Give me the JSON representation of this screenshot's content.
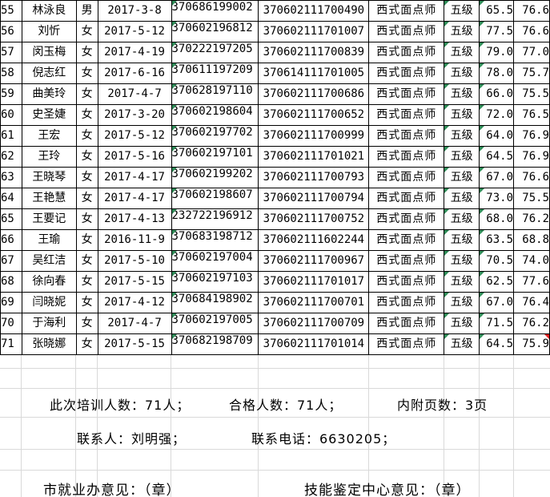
{
  "rows": [
    {
      "no": "55",
      "name": "林泳良",
      "sex": "男",
      "date": "2017-3-8",
      "id": "370686199002",
      "cert": "370602111700490",
      "job": "西式面点师",
      "level": "五级",
      "s1": "65.5",
      "s2": "76.6"
    },
    {
      "no": "56",
      "name": "刘忻",
      "sex": "女",
      "date": "2017-5-12",
      "id": "370602196812",
      "cert": "370602111701007",
      "job": "西式面点师",
      "level": "五级",
      "s1": "77.5",
      "s2": "76.6"
    },
    {
      "no": "57",
      "name": "闵玉梅",
      "sex": "女",
      "date": "2017-4-19",
      "id": "370222197205",
      "cert": "370602111700839",
      "job": "西式面点师",
      "level": "五级",
      "s1": "79.0",
      "s2": "77.0"
    },
    {
      "no": "58",
      "name": "倪志红",
      "sex": "女",
      "date": "2017-6-16",
      "id": "370611197209",
      "cert": "370614111701005",
      "job": "西式面点师",
      "level": "五级",
      "s1": "78.0",
      "s2": "75.7"
    },
    {
      "no": "59",
      "name": "曲美玲",
      "sex": "女",
      "date": "2017-4-7",
      "id": "370628197110",
      "cert": "370602111700686",
      "job": "西式面点师",
      "level": "五级",
      "s1": "66.0",
      "s2": "75.5"
    },
    {
      "no": "60",
      "name": "史圣婕",
      "sex": "女",
      "date": "2017-3-20",
      "id": "370602198604",
      "cert": "370602111700652",
      "job": "西式面点师",
      "level": "五级",
      "s1": "72.0",
      "s2": "76.5"
    },
    {
      "no": "61",
      "name": "王宏",
      "sex": "女",
      "date": "2017-5-12",
      "id": "370602197702",
      "cert": "370602111700999",
      "job": "西式面点师",
      "level": "五级",
      "s1": "64.0",
      "s2": "76.9"
    },
    {
      "no": "62",
      "name": "王玲",
      "sex": "女",
      "date": "2017-5-16",
      "id": "370602197101",
      "cert": "370602111701021",
      "job": "西式面点师",
      "level": "五级",
      "s1": "64.5",
      "s2": "76.9"
    },
    {
      "no": "63",
      "name": "王晓琴",
      "sex": "女",
      "date": "2017-4-17",
      "id": "370602199202",
      "cert": "370602111700793",
      "job": "西式面点师",
      "level": "五级",
      "s1": "67.0",
      "s2": "76.6"
    },
    {
      "no": "64",
      "name": "王艳慧",
      "sex": "女",
      "date": "2017-4-17",
      "id": "370602198607",
      "cert": "370602111700794",
      "job": "西式面点师",
      "level": "五级",
      "s1": "73.0",
      "s2": "75.5"
    },
    {
      "no": "65",
      "name": "王要记",
      "sex": "女",
      "date": "2017-4-13",
      "id": "232722196912",
      "cert": "370602111700752",
      "job": "西式面点师",
      "level": "五级",
      "s1": "68.0",
      "s2": "76.2"
    },
    {
      "no": "66",
      "name": "王瑜",
      "sex": "女",
      "date": "2016-11-9",
      "id": "370683198712",
      "cert": "370602111602244",
      "job": "西式面点师",
      "level": "五级",
      "s1": "63.5",
      "s2": "68.8"
    },
    {
      "no": "67",
      "name": "吴红洁",
      "sex": "女",
      "date": "2017-5-10",
      "id": "370602197004",
      "cert": "370602111700967",
      "job": "西式面点师",
      "level": "五级",
      "s1": "70.5",
      "s2": "74.0"
    },
    {
      "no": "68",
      "name": "徐向春",
      "sex": "女",
      "date": "2017-5-15",
      "id": "370602197103",
      "cert": "370602111701017",
      "job": "西式面点师",
      "level": "五级",
      "s1": "62.5",
      "s2": "77.6"
    },
    {
      "no": "69",
      "name": "闫晓妮",
      "sex": "女",
      "date": "2017-4-12",
      "id": "370684198902",
      "cert": "370602111700701",
      "job": "西式面点师",
      "level": "五级",
      "s1": "67.0",
      "s2": "76.4"
    },
    {
      "no": "70",
      "name": "于海利",
      "sex": "女",
      "date": "2017-4-7",
      "id": "370602197005",
      "cert": "370602111700709",
      "job": "西式面点师",
      "level": "五级",
      "s1": "71.5",
      "s2": "76.2"
    },
    {
      "no": "71",
      "name": "张晓娜",
      "sex": "女",
      "date": "2017-5-15",
      "id": "370682198709",
      "cert": "370602111701014",
      "job": "西式面点师",
      "level": "五级",
      "s1": "64.5",
      "s2": "75.9"
    }
  ],
  "summary": {
    "trained": "此次培训人数：71人；",
    "qualified": "合格人数：71人；",
    "pages": "内附页数：3页"
  },
  "contact": {
    "person": "联系人：刘明强；",
    "phone": "联系电话：6630205；"
  },
  "opinions": {
    "city": "市就业办意见：（章）",
    "center": "技能鉴定中心意见：（章）"
  },
  "colors": {
    "green_marker": "#2e8b57",
    "red_marker": "#e02020",
    "gridline": "#d9d9d9"
  }
}
